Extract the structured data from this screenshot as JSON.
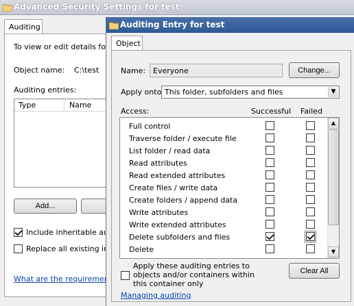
{
  "back_window": {
    "title": "Advanced Security Settings for test",
    "tab": "Auditing",
    "intro": "To view or edit details for a",
    "object_name_label": "Object name:",
    "object_name_value": "C:\\test",
    "entries_label": "Auditing entries:",
    "columns": [
      "Type",
      "Name"
    ],
    "add_button": "Add...",
    "include_inheritable": "Include inheritable audit",
    "replace_all": "Replace all existing inhe",
    "requirements_link": "What are the requirements"
  },
  "dialog": {
    "title": "Auditing Entry for test",
    "tab": "Object",
    "name_label": "Name:",
    "name_value": "Everyone",
    "change_button": "Change...",
    "apply_onto_label": "Apply onto:",
    "apply_onto_value": "This folder, subfolders and files",
    "access_label": "Access:",
    "successful_header": "Successful",
    "failed_header": "Failed",
    "permissions": [
      {
        "label": "Full control",
        "successful": false,
        "failed": false
      },
      {
        "label": "Traverse folder / execute file",
        "successful": false,
        "failed": false
      },
      {
        "label": "List folder / read data",
        "successful": false,
        "failed": false
      },
      {
        "label": "Read attributes",
        "successful": false,
        "failed": false
      },
      {
        "label": "Read extended attributes",
        "successful": false,
        "failed": false
      },
      {
        "label": "Create files / write data",
        "successful": false,
        "failed": false
      },
      {
        "label": "Create folders / append data",
        "successful": false,
        "failed": false
      },
      {
        "label": "Write attributes",
        "successful": false,
        "failed": false
      },
      {
        "label": "Write extended attributes",
        "successful": false,
        "failed": false
      },
      {
        "label": "Delete subfolders and files",
        "successful": true,
        "failed": true
      },
      {
        "label": "Delete",
        "successful": false,
        "failed": false
      }
    ],
    "apply_within_text": "Apply these auditing entries to objects and/or containers within this container only",
    "clear_all_button": "Clear All",
    "managing_link": "Managing auditing"
  }
}
